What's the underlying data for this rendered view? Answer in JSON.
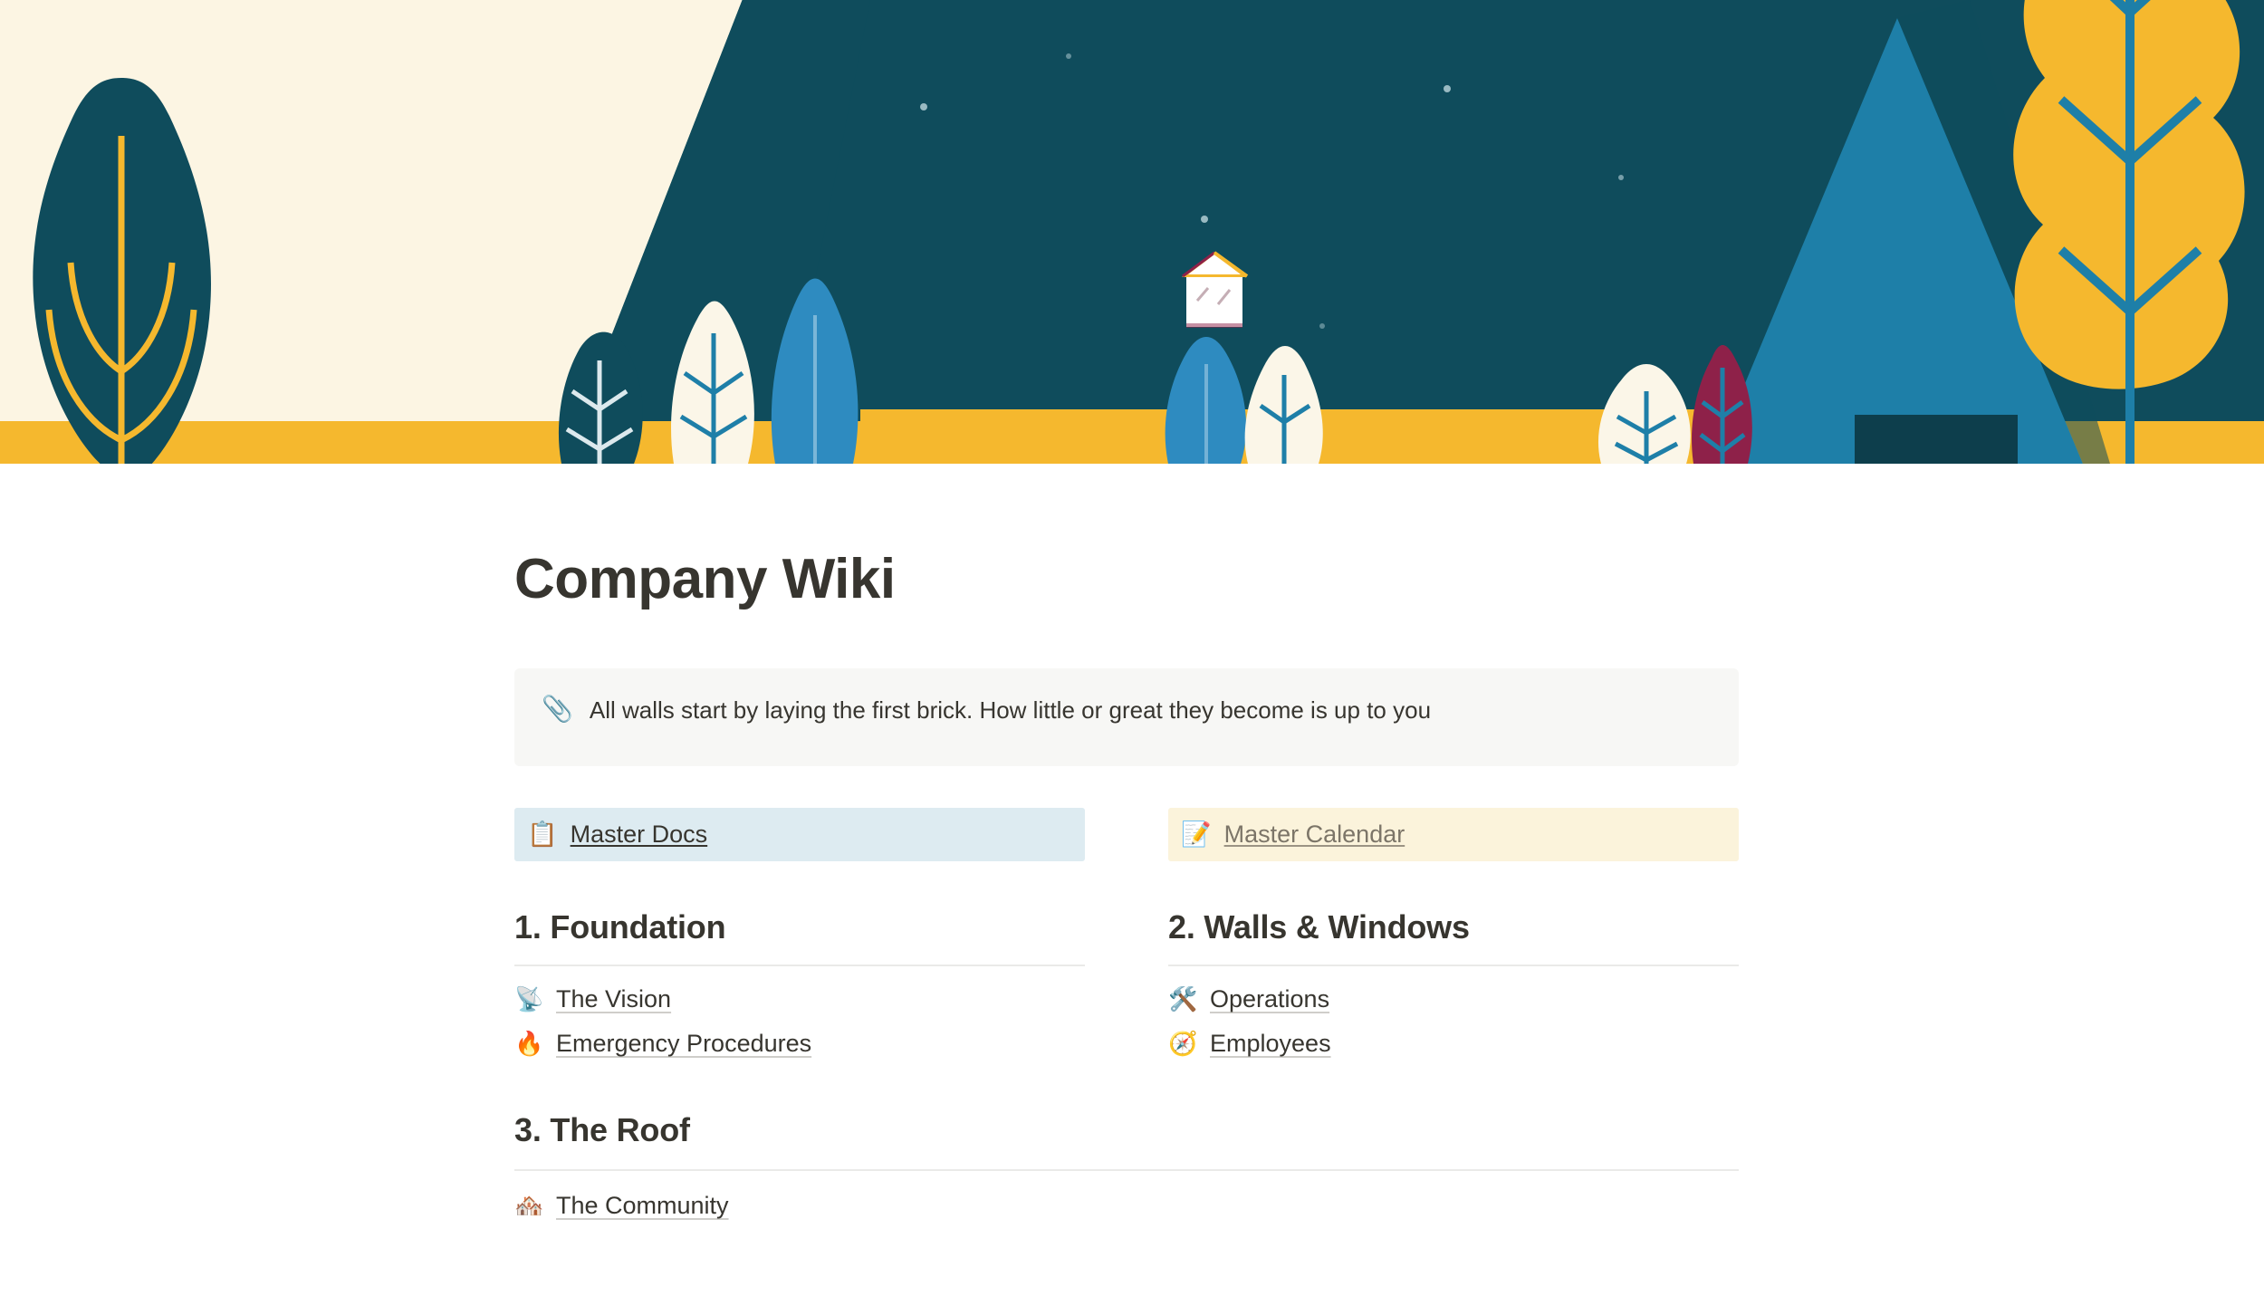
{
  "cover": {
    "name": "company-wiki-cover-illustration",
    "description": "Flat illustration of a night forest with a cabin",
    "palette": {
      "background": "#FCF5E3",
      "dark_teal": "#0F4C5C",
      "mid_blue": "#1E7FA8",
      "light_blue": "#2E8BC0",
      "yellow": "#F5B82E",
      "maroon": "#8E2149",
      "cream": "#FBF6E8",
      "white": "#FFFFFF"
    }
  },
  "page": {
    "title": "Company Wiki"
  },
  "callout": {
    "emoji": "📎",
    "emoji_name": "paperclip-icon",
    "text": "All walls start by laying the first brick. How little or great they become is up to you",
    "background": "#F7F7F5"
  },
  "shortcuts": [
    {
      "emoji": "📋",
      "emoji_name": "clipboard-icon",
      "label": "Master Docs",
      "background": "#DDEBF1",
      "style": "blue"
    },
    {
      "emoji": "📝",
      "emoji_name": "memo-icon",
      "label": "Master Calendar",
      "background": "#FBF3DB",
      "style": "cream"
    }
  ],
  "sections": [
    {
      "heading": "1. Foundation",
      "links": [
        {
          "emoji": "📡",
          "emoji_name": "satellite-antenna-icon",
          "label": "The Vision"
        },
        {
          "emoji": "🔥",
          "emoji_name": "fire-icon",
          "label": "Emergency Procedures"
        }
      ]
    },
    {
      "heading": "2. Walls & Windows",
      "links": [
        {
          "emoji": "🛠️",
          "emoji_name": "hammer-and-wrench-icon",
          "label": "Operations"
        },
        {
          "emoji": "🧭",
          "emoji_name": "compass-icon",
          "label": "Employees"
        }
      ]
    }
  ],
  "roof_section": {
    "heading": "3. The Roof",
    "links": [
      {
        "emoji": "🏘️",
        "emoji_name": "houses-icon",
        "label": "The Community"
      }
    ]
  }
}
